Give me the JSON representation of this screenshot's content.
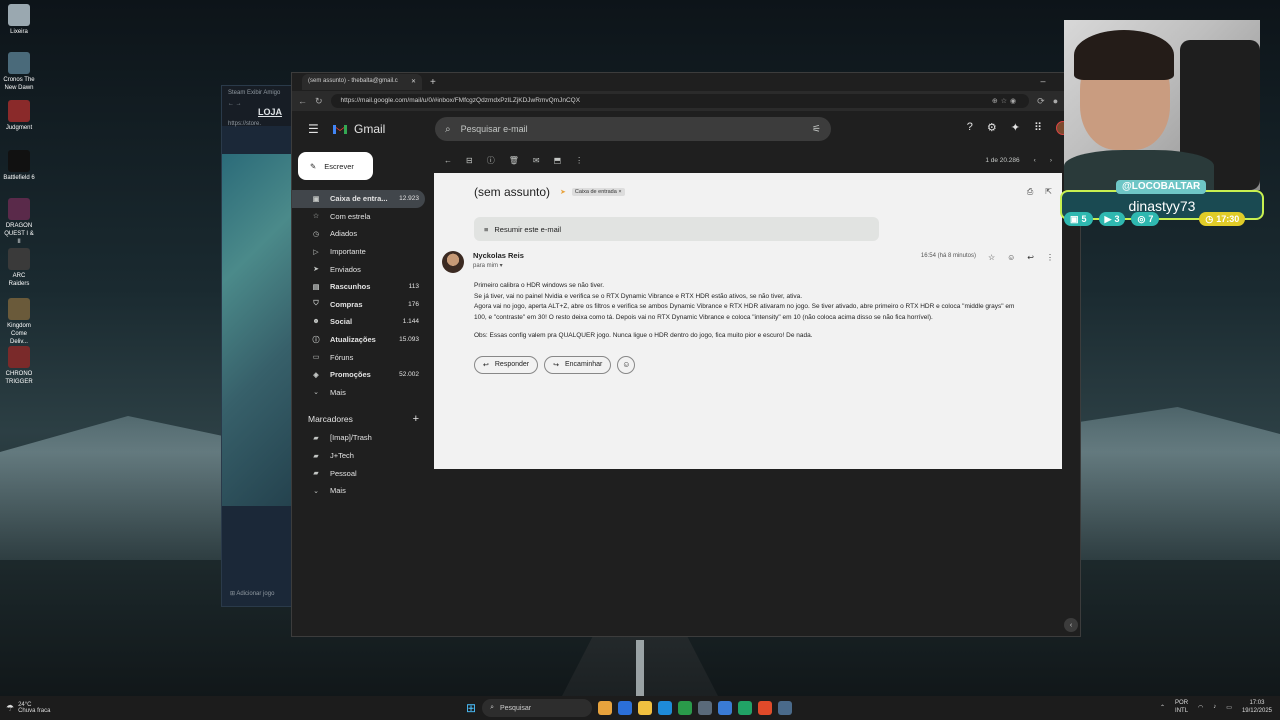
{
  "desktop": {
    "icons": [
      {
        "label": "Lixeira",
        "color": "#9aa8b0"
      },
      {
        "label": "Cronos The New Dawn",
        "color": "#4a6a7a"
      },
      {
        "label": "Judgment",
        "color": "#8a2a2a"
      },
      {
        "label": "Battlefield 6",
        "color": "#111111"
      },
      {
        "label": "DRAGON QUEST I & II",
        "color": "#5a2a4a"
      },
      {
        "label": "ARC Raiders",
        "color": "#3a3a3a"
      },
      {
        "label": "Kingdom Come Deliv...",
        "color": "#6a5a3a"
      },
      {
        "label": "CHRONO TRIGGER",
        "color": "#7a2a2a"
      }
    ]
  },
  "steam": {
    "menu": "Steam  Exibir  Amigo",
    "store_label": "LOJA",
    "url_fragment": "https://store.",
    "add_game": "Adicionar jogo"
  },
  "browser": {
    "tab_title": "(sem assunto) - thebalta@gmail.c",
    "url": "https://mail.google.com/mail/u/0/#inbox/FMfcgzQdzmdxPzlLZjKDJwRmvQmJnCQX"
  },
  "gmail": {
    "app_name": "Gmail",
    "search_placeholder": "Pesquisar e-mail",
    "compose_label": "Escrever",
    "folders": [
      {
        "label": "Caixa de entra...",
        "count": "12.923",
        "icon": "▣",
        "active": true,
        "bold": true
      },
      {
        "label": "Com estrela",
        "count": "",
        "icon": "☆",
        "active": false,
        "bold": false
      },
      {
        "label": "Adiados",
        "count": "",
        "icon": "◷",
        "active": false,
        "bold": false
      },
      {
        "label": "Importante",
        "count": "",
        "icon": "▷",
        "active": false,
        "bold": false
      },
      {
        "label": "Enviados",
        "count": "",
        "icon": "➤",
        "active": false,
        "bold": false
      },
      {
        "label": "Rascunhos",
        "count": "113",
        "icon": "▤",
        "active": false,
        "bold": true
      },
      {
        "label": "Compras",
        "count": "176",
        "icon": "⛉",
        "active": false,
        "bold": true
      },
      {
        "label": "Social",
        "count": "1.144",
        "icon": "☻",
        "active": false,
        "bold": true
      },
      {
        "label": "Atualizações",
        "count": "15.093",
        "icon": "ⓘ",
        "active": false,
        "bold": true
      },
      {
        "label": "Fóruns",
        "count": "",
        "icon": "▭",
        "active": false,
        "bold": false
      },
      {
        "label": "Promoções",
        "count": "52.002",
        "icon": "◈",
        "active": false,
        "bold": true
      },
      {
        "label": "Mais",
        "count": "",
        "icon": "⌄",
        "active": false,
        "bold": false
      }
    ],
    "labels_title": "Marcadores",
    "labels": [
      {
        "label": "[Imap]/Trash",
        "icon": "▰"
      },
      {
        "label": "J+Tech",
        "icon": "▰"
      },
      {
        "label": "Pessoal",
        "icon": "▰"
      },
      {
        "label": "Mais",
        "icon": "⌄"
      }
    ],
    "pager": "1 de 20.286",
    "email": {
      "subject": "(sem assunto)",
      "label_chip": "Caixa de entrada ×",
      "summarize": "Resumir este e-mail",
      "sender": "Nyckolas Reis",
      "to": "para mim ▾",
      "time": "16:54 (há 8 minutos)",
      "body": [
        "Primeiro calibra o HDR windows se não tiver.",
        "Se já tiver, vai no painel Nvidia e verifica se o RTX Dynamic Vibrance e RTX HDR estão ativos, se não tiver, ativa.",
        "Agora vai no jogo, aperta ALT+Z, abre os filtros e verifica se ambos Dynamic Vibrance e RTX HDR ativaram no jogo. Se tiver ativado, abre primeiro o RTX HDR e coloca \"middle grays\" em 100, e \"contraste\" em 30! O resto deixa como tá. Depois vai no RTX Dynamic Vibrance e coloca \"intensity\" em 10 (não coloca acima disso se não fica horrível).",
        "Obs: Essas config valem pra QUALQUER jogo. Nunca ligue o HDR dentro do jogo, fica muito pior e escuro! De nada."
      ],
      "reply_label": "Responder",
      "forward_label": "Encaminhar"
    }
  },
  "overlay": {
    "handle": "@LOCOBALTAR",
    "name": "dinastyy73",
    "stats": [
      "5",
      "3",
      "7"
    ],
    "timer": "17:30",
    "accent": "#2fb8b0",
    "timer_color": "#e0cc28"
  },
  "taskbar": {
    "weather_temp": "24°C",
    "weather_desc": "Chuva fraca",
    "search_label": "Pesquisar",
    "lang_1": "POR",
    "lang_2": "INTL",
    "time": "17:03",
    "date": "19/12/2025",
    "app_colors": [
      "#e8a33d",
      "#2b6fd8",
      "#f0c040",
      "#1e8bd8",
      "#2a9a4a",
      "#5a6a7a",
      "#3a7bd5",
      "#21a366",
      "#e04a2a",
      "#4a6a8a"
    ]
  }
}
